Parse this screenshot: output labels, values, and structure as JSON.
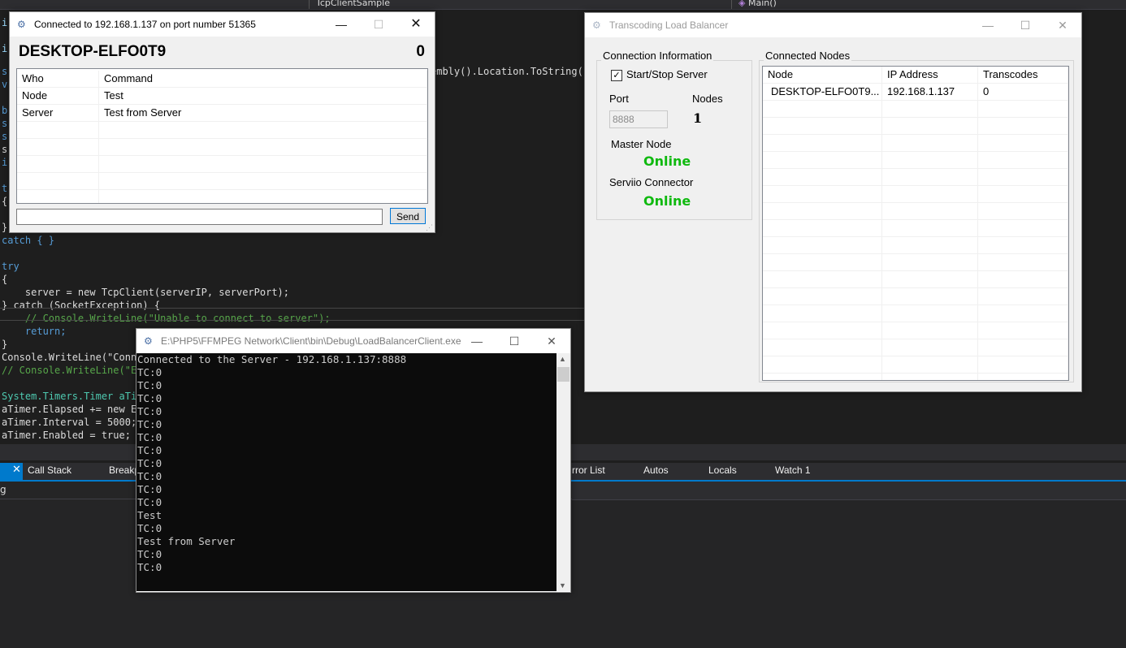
{
  "ide": {
    "project_dropdown": "TcpClientSample",
    "method_dropdown": "Main()",
    "code_lines": {
      "l_assembly": "embly().Location.ToString()",
      "l_catch": "catch { }",
      "l_try": "try",
      "l_open1": "{",
      "l_server": "    server = new TcpClient(serverIP, serverPort);",
      "l_catch2": "} catch (SocketException) {",
      "l_comment1": "    // Console.WriteLine(\"Unable to connect to server\");",
      "l_return": "    return;",
      "l_close": "}",
      "l_writeline": "Console.WriteLine(\"Conne",
      "l_comment2": "// Console.WriteLine(\"En",
      "l_timer": "System.Timers.Timer aTim",
      "l_elapsed": "aTimer.Elapsed += new El",
      "l_interval": "aTimer.Interval = 5000;",
      "l_enabled": "aTimer.Enabled = true;"
    },
    "bottom_tabs": {
      "call_stack": "Call Stack",
      "breakpoints": "Breakp",
      "error_list": "rror List",
      "autos": "Autos",
      "locals": "Locals",
      "watch": "Watch 1"
    },
    "panel_fragment": "g"
  },
  "client_window": {
    "title": "Connected to 192.168.1.137 on port number 51365",
    "machine_name": "DESKTOP-ELFO0T9",
    "counter": "0",
    "columns": [
      "Who",
      "Command"
    ],
    "rows": [
      {
        "who": "Node",
        "command": "Test"
      },
      {
        "who": "Server",
        "command": "Test from Server"
      }
    ],
    "message_input": "",
    "send_label": "Send"
  },
  "balancer_window": {
    "title": "Transcoding Load Balancer",
    "connection_group": "Connection Information",
    "start_stop_label": "Start/Stop Server",
    "start_stop_checked": true,
    "port_label": "Port",
    "port_value": "8888",
    "nodes_label": "Nodes",
    "nodes_value": "1",
    "master_node_label": "Master Node",
    "master_node_status": "Online",
    "serviio_label": "Serviio Connector",
    "serviio_status": "Online",
    "status_color": "#0fb90f",
    "nodes_group": "Connected Nodes",
    "columns": [
      "Node",
      "IP Address",
      "Transcodes"
    ],
    "rows": [
      {
        "node": "DESKTOP-ELFO0T9...",
        "ip": "192.168.1.137",
        "transcodes": "0"
      }
    ]
  },
  "console_window": {
    "title": "E:\\PHP5\\FFMPEG Network\\Client\\bin\\Debug\\LoadBalancerClient.exe",
    "lines": [
      "Connected to the Server - 192.168.1.137:8888",
      "TC:0",
      "TC:0",
      "TC:0",
      "TC:0",
      "TC:0",
      "TC:0",
      "TC:0",
      "TC:0",
      "TC:0",
      "TC:0",
      "TC:0",
      "Test",
      "TC:0",
      "Test from Server",
      "TC:0",
      "TC:0"
    ]
  }
}
